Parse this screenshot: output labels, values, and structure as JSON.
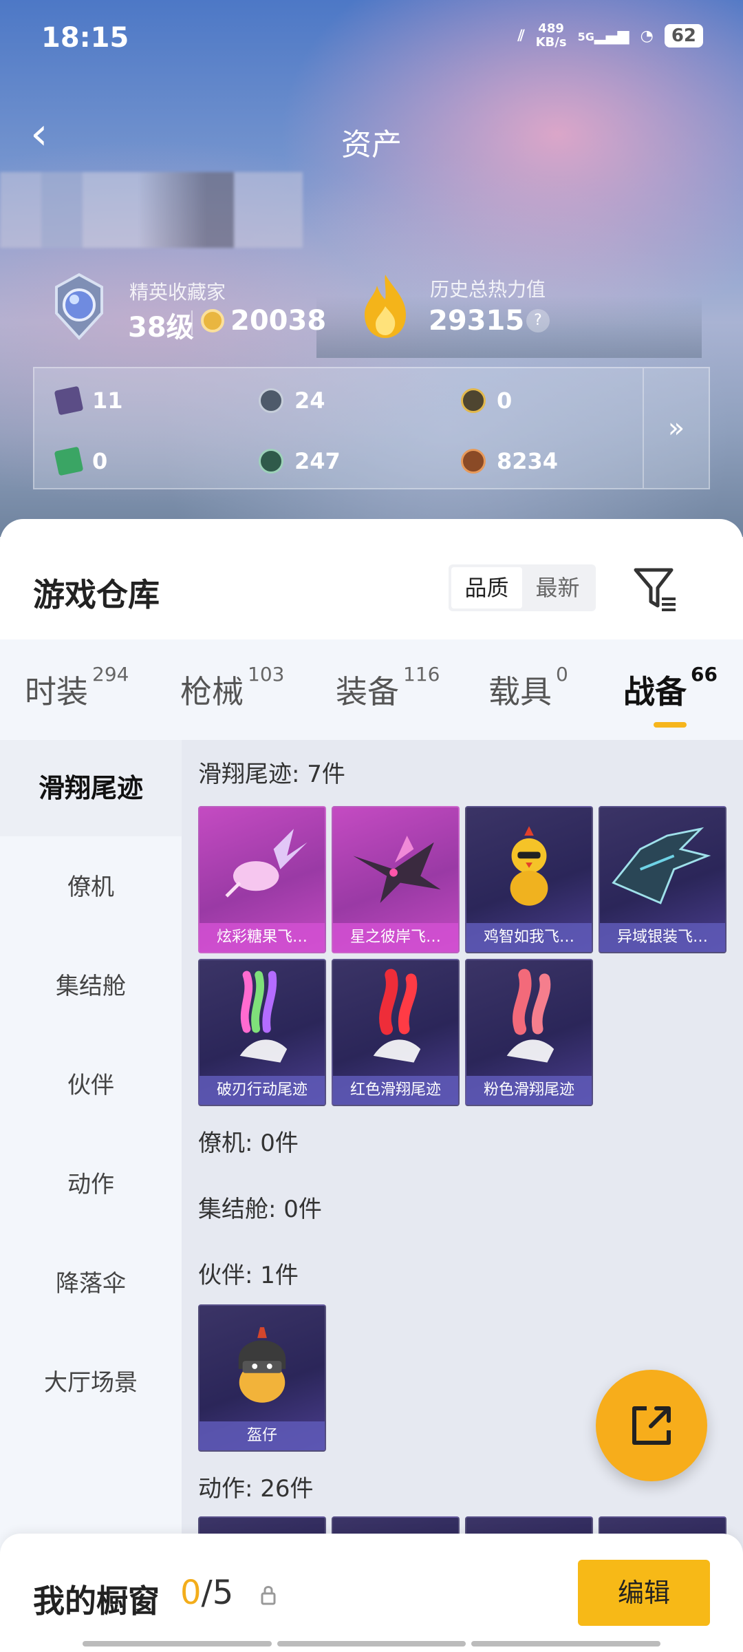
{
  "status": {
    "time": "18:15",
    "speed_value": "489",
    "speed_unit": "KB/s",
    "network": "5G",
    "battery": "62"
  },
  "nav": {
    "title": "资产",
    "back_glyph": "‹"
  },
  "rank": {
    "label": "精英收藏家",
    "level": "38级",
    "coins": "20038"
  },
  "heat": {
    "label": "历史总热力值",
    "value": "29315",
    "help": "?"
  },
  "stats": {
    "items": [
      "11",
      "24",
      "0",
      "0",
      "247",
      "8234"
    ],
    "more_glyph": "»"
  },
  "warehouse": {
    "title": "游戏仓库",
    "sort": [
      "品质",
      "最新"
    ],
    "tabs": [
      {
        "label": "时装",
        "count": "294"
      },
      {
        "label": "枪械",
        "count": "103"
      },
      {
        "label": "装备",
        "count": "116"
      },
      {
        "label": "载具",
        "count": "0"
      },
      {
        "label": "战备",
        "count": "66"
      }
    ],
    "categories": [
      "滑翔尾迹",
      "僚机",
      "集结舱",
      "伙伴",
      "动作",
      "降落伞",
      "大厅场景"
    ]
  },
  "sections": {
    "glide": {
      "label": "滑翔尾迹: 7件",
      "items": [
        "炫彩糖果飞…",
        "星之彼岸飞…",
        "鸡智如我飞…",
        "异域银装飞…",
        "破刃行动尾迹",
        "红色滑翔尾迹",
        "粉色滑翔尾迹"
      ]
    },
    "wingman": {
      "label": "僚机: 0件"
    },
    "pod": {
      "label": "集结舱: 0件"
    },
    "partner": {
      "label": "伙伴: 1件",
      "items": [
        "盔仔"
      ]
    },
    "emote": {
      "label": "动作: 26件"
    }
  },
  "showcase": {
    "label": "我的橱窗",
    "current": "0",
    "total": "/5",
    "edit": "编辑"
  },
  "colors": {
    "accent": "#f7b917",
    "card_purple": "#2b2659",
    "card_pink": "#c44bc2"
  }
}
